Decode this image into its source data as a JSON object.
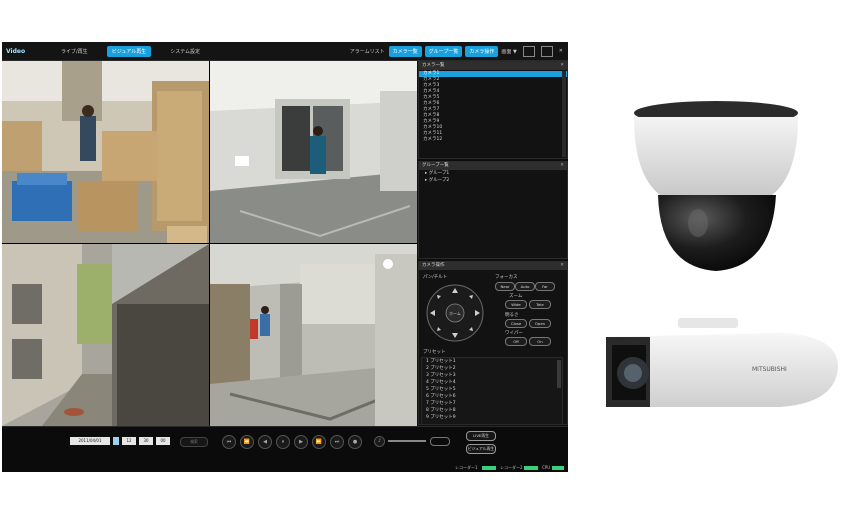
{
  "topbar": {
    "logo": "Video",
    "tabs": [
      "ライブ/再生",
      "ビジュアル再生",
      "システム設定"
    ],
    "alarm_label": "アラームリスト",
    "buttons": [
      "カメラ一覧",
      "グループ一覧",
      "カメラ操作"
    ],
    "misc": "画面 ▼"
  },
  "camera_list": {
    "title": "カメラ一覧",
    "items": [
      "カメラ1",
      "カメラ2",
      "カメラ3",
      "カメラ4",
      "カメラ5",
      "カメラ6",
      "カメラ7",
      "カメラ8",
      "カメラ9",
      "カメラ10",
      "カメラ11",
      "カメラ12"
    ]
  },
  "group_list": {
    "title": "グループ一覧",
    "items": [
      "グループ1",
      "グループ2"
    ]
  },
  "camera_control": {
    "title": "カメラ操作",
    "pantilt_label": "パン/チルト",
    "focus_label": "フォーカス",
    "focus_buttons": [
      "Near",
      "Auto",
      "Far"
    ],
    "zoom_label": "ズーム",
    "zoom_buttons": [
      "Wide",
      "Tele"
    ],
    "iris_label": "明るさ",
    "iris_buttons": [
      "Close",
      "Open"
    ],
    "wiper_label": "ワイパー",
    "wiper_buttons": [
      "Off",
      "On"
    ],
    "center_label": "ホーム",
    "preset_label": "プリセット",
    "presets": [
      "1 プリセット1",
      "2 プリセット2",
      "3 プリセット3",
      "4 プリセット4",
      "5 プリセット5",
      "6 プリセット6",
      "7 プリセット7",
      "8 プリセット8",
      "9 プリセット9"
    ]
  },
  "playback": {
    "date": "2011/04/01",
    "hour": "12",
    "minute": "30",
    "second": "00",
    "search_label": "検索",
    "buttons_right": [
      "LIVE再生",
      "ビジュアル再生"
    ],
    "status": [
      "レコーダー1",
      "レコーダー2",
      "CPU"
    ]
  },
  "products": {
    "camera_brand": "MITSUBISHI"
  },
  "colors": {
    "accent": "#1aa0dd",
    "status_green": "#37d27a"
  }
}
